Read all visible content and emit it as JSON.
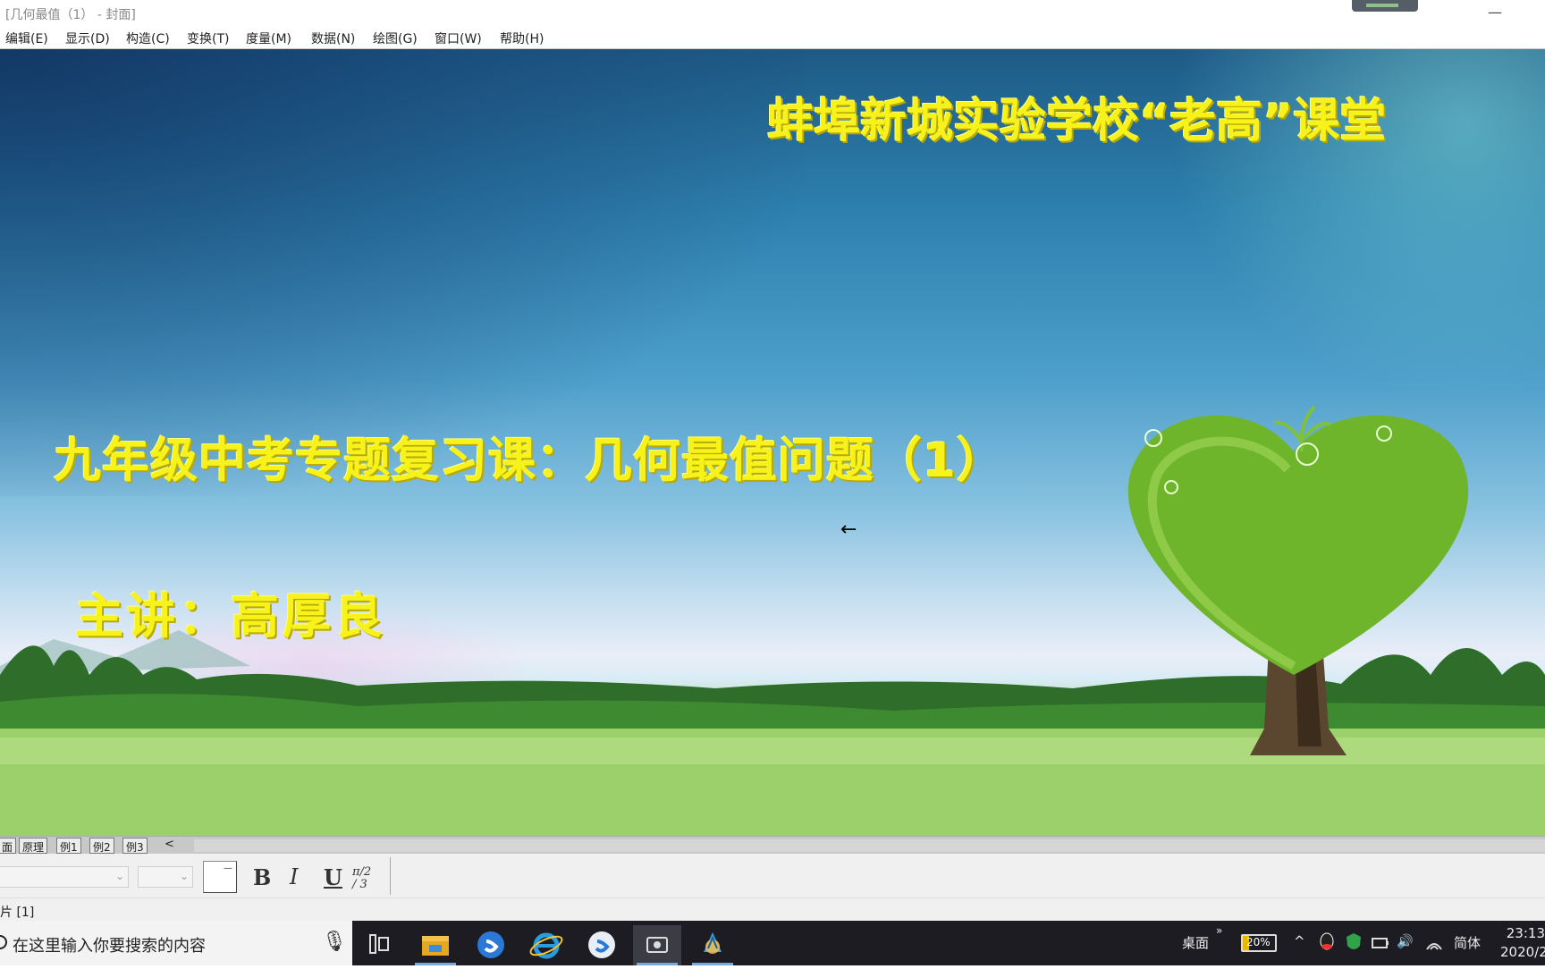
{
  "window": {
    "title": "[几何最值（1） - 封面]",
    "minimize_glyph": "—"
  },
  "menu": [
    "编辑(E)",
    "显示(D)",
    "构造(C)",
    "变换(T)",
    "度量(M)",
    "数据(N)",
    "绘图(G)",
    "窗口(W)",
    "帮助(H)"
  ],
  "slide": {
    "school": "蚌埠新城实验学校“老高”课堂",
    "lesson": "九年级中考专题复习课：几何最值问题（1）",
    "teacher": "主讲：高厚良",
    "cursor": "←"
  },
  "page_tabs": [
    "面",
    "原理",
    "例1",
    "例2",
    "例3"
  ],
  "page_tabs_scroll": "<",
  "toolbar": {
    "color_dash": "—",
    "bold": "B",
    "italic": "I",
    "underline": "U",
    "math_format": "π/2 / 3",
    "combo_arrow": "⌄"
  },
  "status": "片 [1]",
  "taskbar": {
    "search_placeholder": "在这里输入你要搜索的内容",
    "mic": "🎙",
    "desktop_label": "桌面",
    "more": "»",
    "battery_percent": "20%",
    "battery_level": 0.2,
    "ime": "简体",
    "time": "23:13",
    "date": "2020/2",
    "tray_chevron": "^",
    "volume": "🔊",
    "icons": [
      "task-view-icon",
      "file-explorer-icon",
      "sogou-browser-icon",
      "ie-icon",
      "sogou-input-icon",
      "camera-app-icon",
      "geometers-sketchpad-icon"
    ]
  },
  "colors": {
    "title_yellow": "#f7f21a",
    "taskbar_bg": "#1c1c22"
  }
}
